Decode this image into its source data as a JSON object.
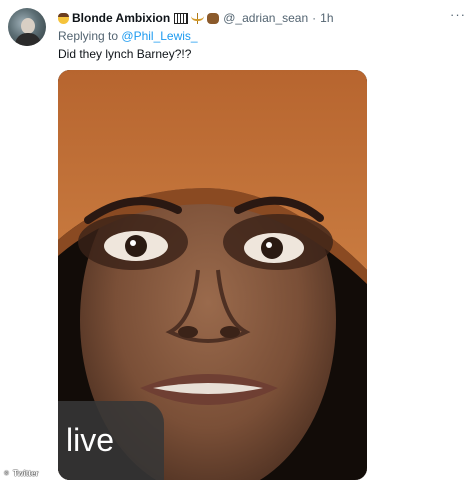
{
  "tweet": {
    "display_name": "Blonde Ambixion",
    "handle": "@_adrian_sean",
    "separator": "·",
    "time": "1h",
    "more_icon": "more-horizontal-icon",
    "reply_prefix": "Replying to",
    "reply_handle": "@Phil_Lewis_",
    "text": "Did they lynch Barney?!?"
  },
  "media": {
    "badge": "live"
  },
  "watermark": {
    "symbol": "©",
    "label": "Twitter"
  },
  "colors": {
    "link": "#1d9bf0",
    "secondary_text": "#536471",
    "primary_text": "#0f1419",
    "hat": "#c2703a"
  }
}
